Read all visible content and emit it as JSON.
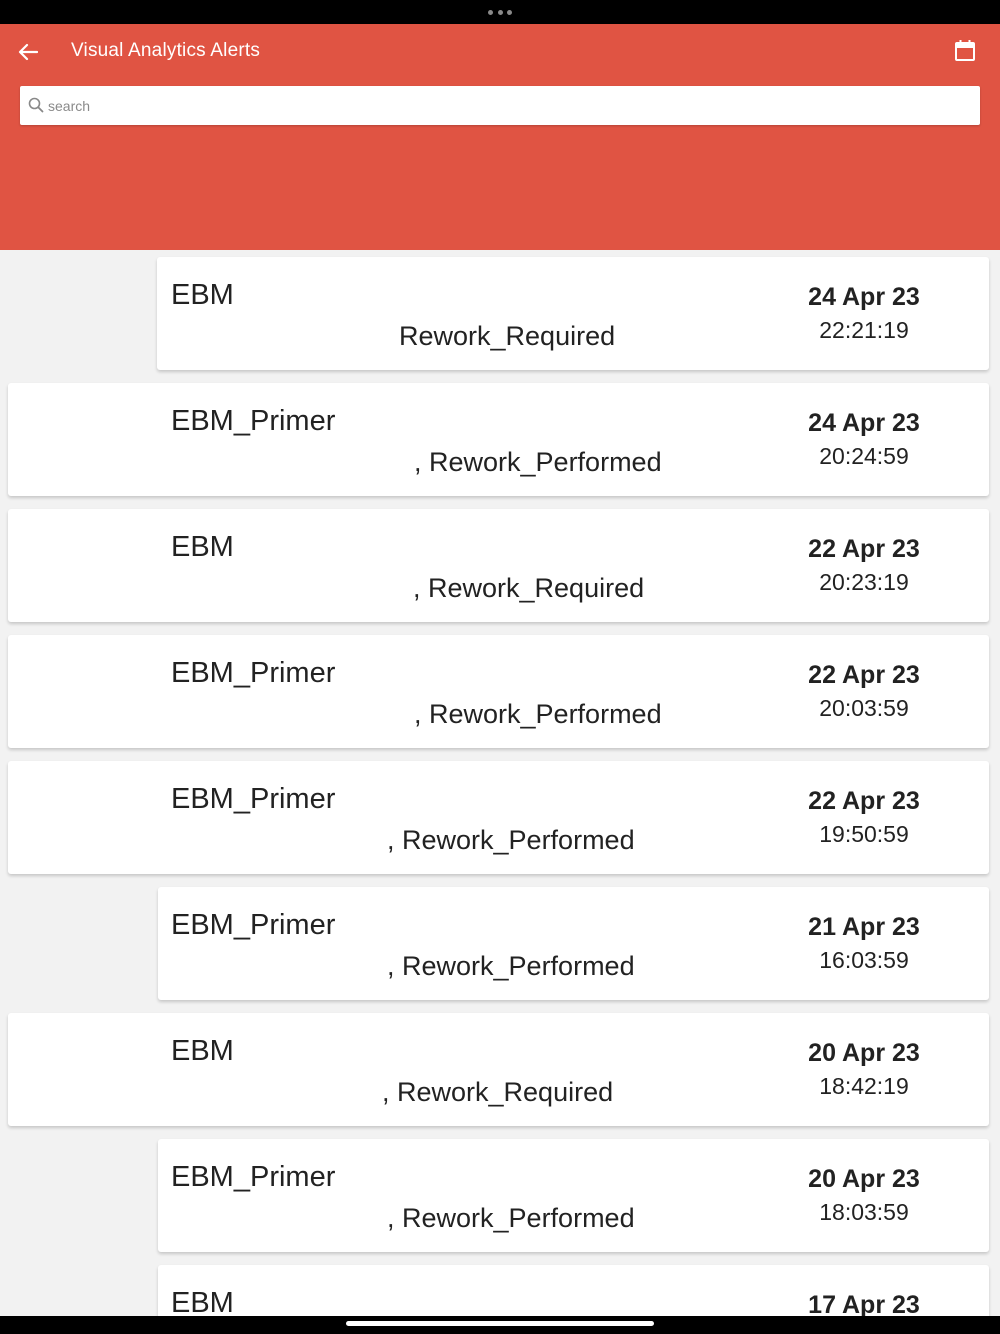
{
  "header": {
    "title": "Visual Analytics Alerts",
    "bg_color": "#e05443",
    "back_icon": "arrow-left-icon",
    "calendar_icon": "calendar-icon"
  },
  "search": {
    "placeholder": "search",
    "value": ""
  },
  "alerts": [
    {
      "name": "EBM",
      "type": "Rework_Required",
      "date": "24 Apr 23",
      "time": "22:21:19"
    },
    {
      "name": "EBM_Primer",
      "type": ", Rework_Performed",
      "date": "24 Apr 23",
      "time": "20:24:59"
    },
    {
      "name": "EBM",
      "type": ", Rework_Required",
      "date": "22 Apr 23",
      "time": "20:23:19"
    },
    {
      "name": "EBM_Primer",
      "type": ", Rework_Performed",
      "date": "22 Apr 23",
      "time": "20:03:59"
    },
    {
      "name": "EBM_Primer",
      "type": ", Rework_Performed",
      "date": "22 Apr 23",
      "time": "19:50:59"
    },
    {
      "name": "EBM_Primer",
      "type": ", Rework_Performed",
      "date": "21 Apr 23",
      "time": "16:03:59"
    },
    {
      "name": "EBM",
      "type": ", Rework_Required",
      "date": "20 Apr 23",
      "time": "18:42:19"
    },
    {
      "name": "EBM_Primer",
      "type": ", Rework_Performed",
      "date": "20 Apr 23",
      "time": "18:03:59"
    },
    {
      "name": "EBM",
      "type": "",
      "date": "17 Apr 23",
      "time": ""
    }
  ]
}
